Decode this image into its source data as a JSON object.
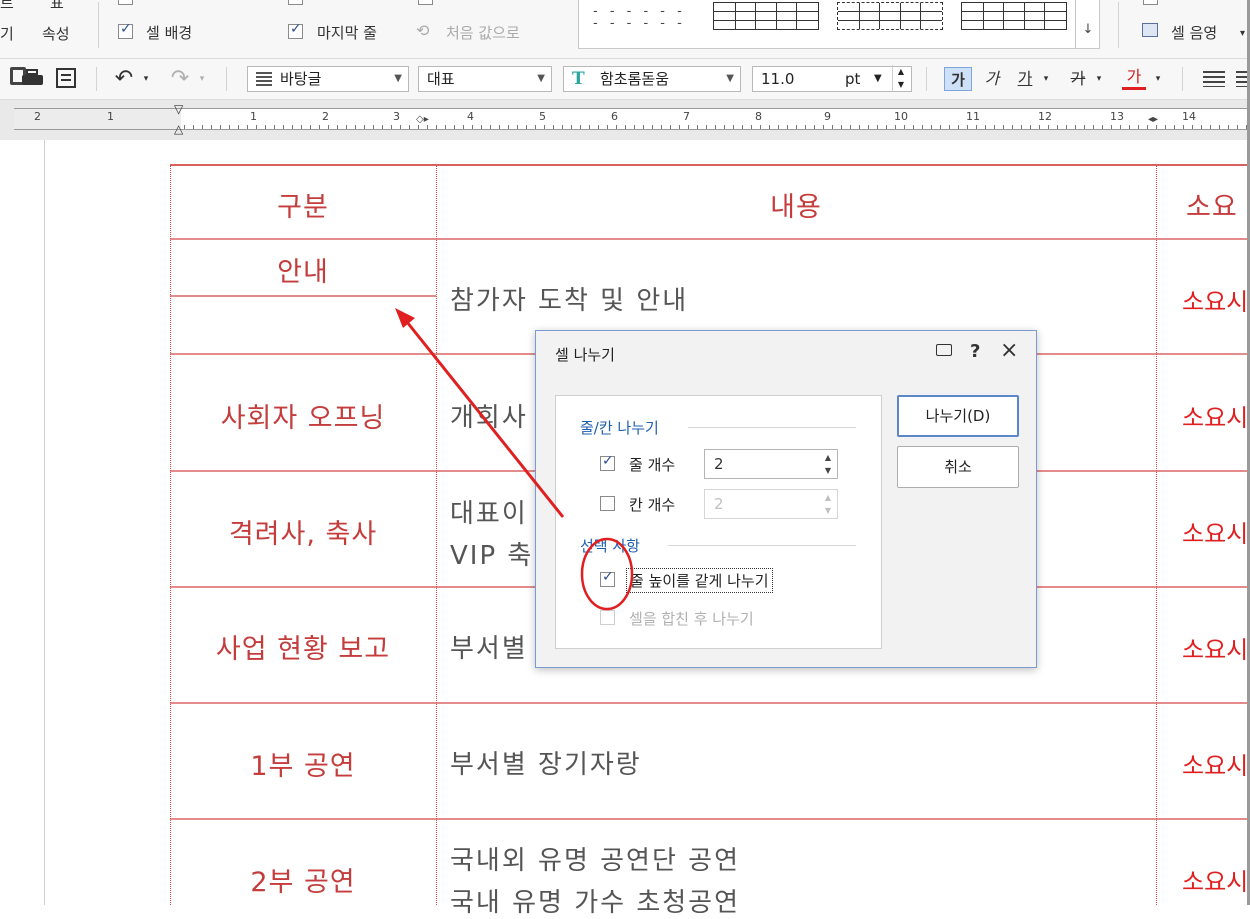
{
  "ribbon": {
    "left_labels": [
      "트",
      "표",
      "기",
      "속성"
    ],
    "checkbox_cell_bg": "셀 배경",
    "checkbox_last_row": "마지막 줄",
    "first_value_label": "처음 값으로",
    "cell_shade_label": "셀 음영"
  },
  "toolbar": {
    "para_style": "바탕글",
    "style_name": "대표",
    "font_name": "함초롬돋움",
    "font_size": "11.0",
    "font_unit": "pt",
    "bold_char": "가",
    "italic_char": "가",
    "underline_char": "가",
    "strike_char": "가",
    "color_char": "가"
  },
  "ruler": {
    "numbers": [
      "2",
      "1",
      "1",
      "2",
      "3",
      "4",
      "5",
      "6",
      "7",
      "8",
      "9",
      "10",
      "11",
      "12",
      "13",
      "14"
    ]
  },
  "table": {
    "header": [
      "구분",
      "내용",
      "소요"
    ],
    "rows": [
      {
        "category": "안내",
        "content": [
          "참가자 도착 및 안내"
        ],
        "req": "소요시"
      },
      {
        "category": "사회자 오프닝",
        "content": [
          "개회사"
        ],
        "req": "소요시"
      },
      {
        "category": "격려사, 축사",
        "content": [
          "대표이",
          "VIP 축"
        ],
        "req": "소요시"
      },
      {
        "category": "사업 현황 보고",
        "content": [
          "부서별"
        ],
        "req": "소요시"
      },
      {
        "category": "1부 공연",
        "content": [
          "부서별 장기자랑"
        ],
        "req": "소요시"
      },
      {
        "category": "2부 공연",
        "content": [
          "국내외 유명 공연단 공연",
          "국내 유명 가수 초청공연"
        ],
        "req": "소요시"
      }
    ]
  },
  "dialog": {
    "title": "셀 나누기",
    "help": "?",
    "close": "×",
    "group_split": "줄/칸 나누기",
    "row_count_label": "줄 개수",
    "row_count_value": "2",
    "col_count_label": "칸 개수",
    "col_count_value": "2",
    "group_options": "선택 사항",
    "equal_height_label": "줄 높이를 같게 나누기",
    "merge_then_split_label": "셀을 합친 후 나누기",
    "ok_label": "나누기(D)",
    "cancel_label": "취소"
  },
  "annotation_color": "#e02020"
}
